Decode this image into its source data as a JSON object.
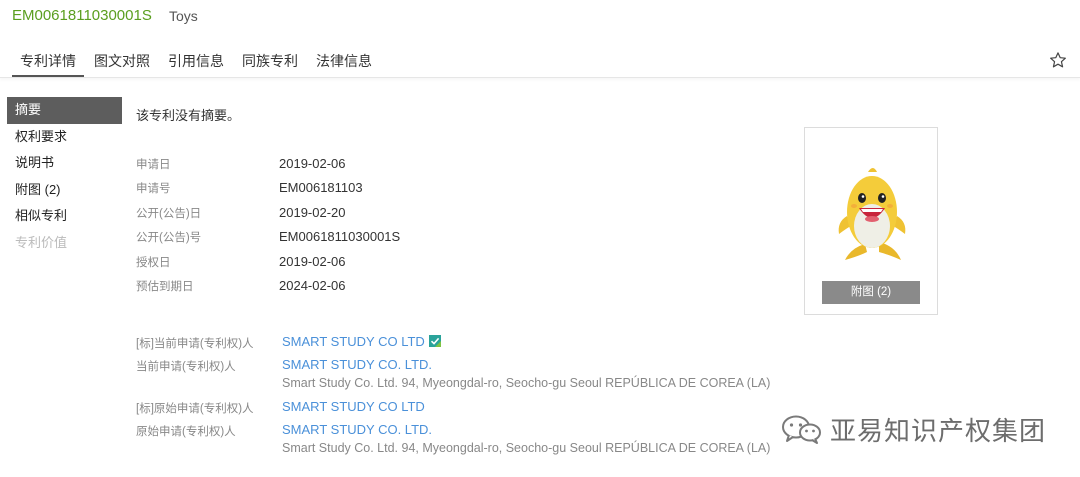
{
  "header": {
    "publication_number": "EM0061811030001S",
    "title": "Toys"
  },
  "tabs": [
    {
      "label": "专利详情"
    },
    {
      "label": "图文对照"
    },
    {
      "label": "引用信息"
    },
    {
      "label": "同族专利"
    },
    {
      "label": "法律信息"
    }
  ],
  "sidebar": {
    "items": [
      {
        "label": "摘要"
      },
      {
        "label": "权利要求"
      },
      {
        "label": "说明书"
      },
      {
        "label": "附图 (2)"
      },
      {
        "label": "相似专利"
      },
      {
        "label": "专利价值"
      }
    ]
  },
  "abstract_text": "该专利没有摘要。",
  "details": [
    {
      "label": "申请日",
      "value": "2019-02-06"
    },
    {
      "label": "申请号",
      "value": "EM006181103"
    },
    {
      "label": "公开(公告)日",
      "value": "2019-02-20"
    },
    {
      "label": "公开(公告)号",
      "value": "EM0061811030001S"
    },
    {
      "label": "授权日",
      "value": "2019-02-06"
    },
    {
      "label": "预估到期日",
      "value": "2024-02-06"
    }
  ],
  "owners": [
    {
      "label": "[标]当前申请(专利权)人",
      "name": "SMART STUDY CO LTD",
      "address": ""
    },
    {
      "label": "当前申请(专利权)人",
      "name": "SMART STUDY CO. LTD.",
      "address": "Smart Study Co. Ltd. 94, Myeongdal-ro, Seocho-gu Seoul REPÚBLICA DE COREA (LA)"
    },
    {
      "label": "[标]原始申请(专利权)人",
      "name": "SMART STUDY CO LTD",
      "address": ""
    },
    {
      "label": "原始申请(专利权)人",
      "name": "SMART STUDY CO. LTD.",
      "address": "Smart Study Co. Ltd. 94, Myeongdal-ro, Seocho-gu Seoul REPÚBLICA DE COREA (LA)"
    }
  ],
  "figure": {
    "button_label": "附图 (2)"
  },
  "watermark": {
    "text": "亚易知识产权集团"
  },
  "colors": {
    "publication_number": "#5a9e1f",
    "link": "#4a90d9",
    "sidebar_active_bg": "#5d5d5d",
    "figure_button_bg": "#8a8a8a"
  },
  "icons": [
    "star-icon",
    "verified-badge-icon",
    "shark-toy-image",
    "wechat-icon"
  ]
}
